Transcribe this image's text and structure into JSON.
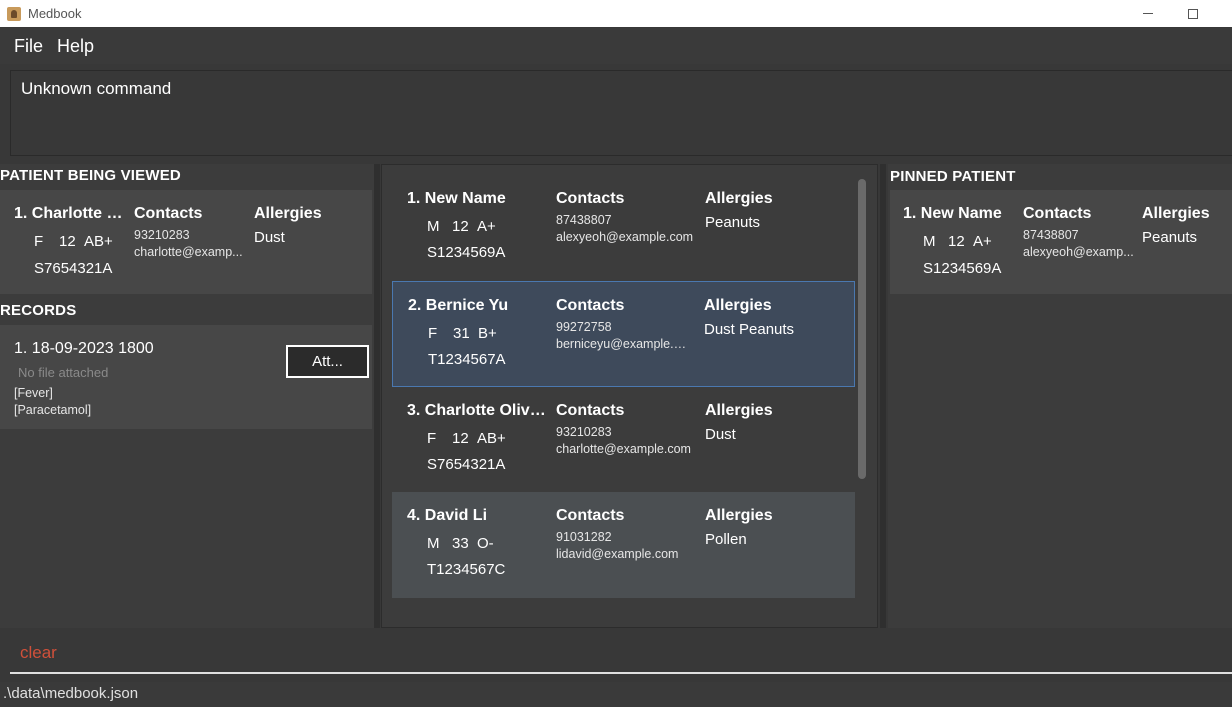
{
  "window": {
    "title": "Medbook"
  },
  "menu": {
    "file": "File",
    "help": "Help"
  },
  "result_text": "Unknown command",
  "viewed": {
    "section_title": "PATIENT BEING VIEWED",
    "name": "1. Charlotte O...",
    "gender": "F",
    "age": "12",
    "blood": "AB+",
    "nric": "S7654321A",
    "contacts_label": "Contacts",
    "phone": "93210283",
    "email": "charlotte@examp...",
    "allergies_label": "Allergies",
    "allergies": "Dust"
  },
  "records": {
    "section_title": "RECORDS",
    "items": [
      {
        "title": "1. 18-09-2023 1800",
        "file_status": "No file attached",
        "condition": "[Fever]",
        "medication": "[Paracetamol]",
        "attach_label": "Att..."
      }
    ]
  },
  "patients": [
    {
      "name": "1. New Name",
      "gender": "M",
      "age": "12",
      "blood": "A+",
      "nric": "S1234569A",
      "contacts_label": "Contacts",
      "phone": "87438807",
      "email": "alexyeoh@example.com",
      "allergies_label": "Allergies",
      "allergies": "Peanuts"
    },
    {
      "name": "2. Bernice Yu",
      "gender": "F",
      "age": "31",
      "blood": "B+",
      "nric": "T1234567A",
      "contacts_label": "Contacts",
      "phone": "99272758",
      "email": "berniceyu@example.c...",
      "allergies_label": "Allergies",
      "allergies": "Dust Peanuts"
    },
    {
      "name": "3. Charlotte Olive...",
      "gender": "F",
      "age": "12",
      "blood": "AB+",
      "nric": "S7654321A",
      "contacts_label": "Contacts",
      "phone": "93210283",
      "email": "charlotte@example.com",
      "allergies_label": "Allergies",
      "allergies": "Dust"
    },
    {
      "name": "4. David Li",
      "gender": "M",
      "age": "33",
      "blood": "O-",
      "nric": "T1234567C",
      "contacts_label": "Contacts",
      "phone": "91031282",
      "email": "lidavid@example.com",
      "allergies_label": "Allergies",
      "allergies": "Pollen"
    }
  ],
  "pinned": {
    "section_title": "PINNED PATIENT",
    "name": "1. New Name",
    "gender": "M",
    "age": "12",
    "blood": "A+",
    "nric": "S1234569A",
    "contacts_label": "Contacts",
    "phone": "87438807",
    "email": "alexyeoh@examp...",
    "allergies_label": "Allergies",
    "allergies": "Peanuts"
  },
  "command_input": "clear",
  "status_path": ".\\data\\medbook.json"
}
